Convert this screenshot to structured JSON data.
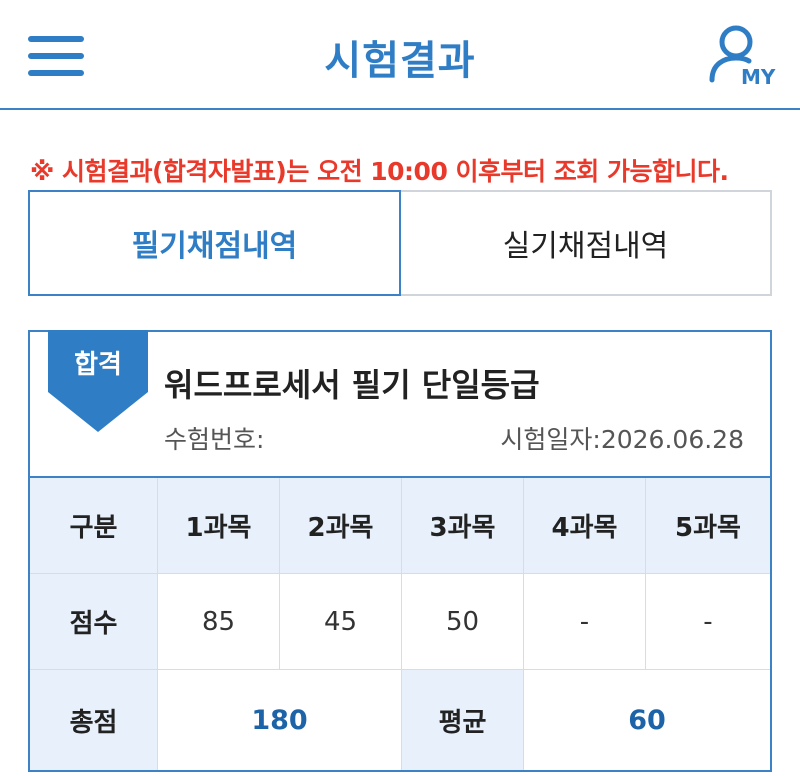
{
  "header": {
    "title": "시험결과",
    "menu_icon": "hamburger-icon",
    "my_icon": "user-my-icon",
    "my_label": "MY"
  },
  "notice": "※ 시험결과(합격자발표)는 오전 10:00 이후부터 조회 가능합니다.",
  "tabs": [
    {
      "label": "필기채점내역",
      "active": true
    },
    {
      "label": "실기채점내역",
      "active": false
    }
  ],
  "result": {
    "badge": "합격",
    "exam_name": "워드프로세서 필기 단일등급",
    "exam_number_label": "수험번호:",
    "exam_date": "시험일자:2026.06.28",
    "table": {
      "headers": [
        "구분",
        "1과목",
        "2과목",
        "3과목",
        "4과목",
        "5과목"
      ],
      "score_label": "점수",
      "scores": [
        "85",
        "45",
        "50",
        "-",
        "-"
      ],
      "total_label": "총점",
      "total_value": "180",
      "average_label": "평균",
      "average_value": "60"
    }
  },
  "colors": {
    "primary": "#2f7dc4",
    "notice_red": "#e8392b",
    "header_cell_bg": "#e8f1fb",
    "value_blue": "#1d63a8"
  }
}
